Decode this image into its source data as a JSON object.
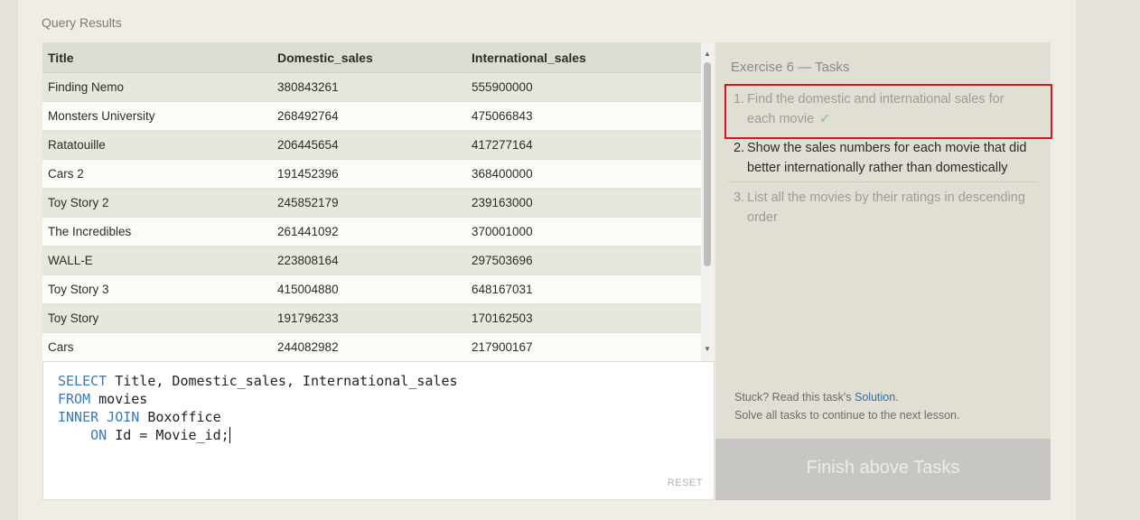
{
  "results": {
    "title": "Query Results",
    "columns": [
      "Title",
      "Domestic_sales",
      "International_sales"
    ],
    "rows": [
      [
        "Finding Nemo",
        "380843261",
        "555900000"
      ],
      [
        "Monsters University",
        "268492764",
        "475066843"
      ],
      [
        "Ratatouille",
        "206445654",
        "417277164"
      ],
      [
        "Cars 2",
        "191452396",
        "368400000"
      ],
      [
        "Toy Story 2",
        "245852179",
        "239163000"
      ],
      [
        "The Incredibles",
        "261441092",
        "370001000"
      ],
      [
        "WALL-E",
        "223808164",
        "297503696"
      ],
      [
        "Toy Story 3",
        "415004880",
        "648167031"
      ],
      [
        "Toy Story",
        "191796233",
        "170162503"
      ],
      [
        "Cars",
        "244082982",
        "217900167"
      ]
    ]
  },
  "editor": {
    "query_lines": [
      "SELECT Title, Domestic_sales, International_sales",
      "FROM movies",
      "INNER JOIN Boxoffice",
      "    ON Id = Movie_id;"
    ],
    "reset_label": "RESET"
  },
  "tasks": {
    "title": "Exercise 6 — Tasks",
    "items": [
      {
        "num": "1.",
        "text": "Find the domestic and international sales for each movie",
        "status": "done"
      },
      {
        "num": "2.",
        "text": "Show the sales numbers for each movie that did better internationally rather than domestically",
        "status": "active"
      },
      {
        "num": "3.",
        "text": "List all the movies by their ratings in descending order",
        "status": "pending"
      }
    ],
    "help_prefix": "Stuck? Read this task's ",
    "solution_link": "Solution",
    "help_suffix": ".",
    "help_line2": "Solve all tasks to continue to the next lesson.",
    "finish_label": "Finish above Tasks",
    "check_mark": "✓"
  },
  "colors": {
    "keyword": "#3d78b5",
    "highlight_border": "#e2141b",
    "check": "#7cc07a"
  }
}
